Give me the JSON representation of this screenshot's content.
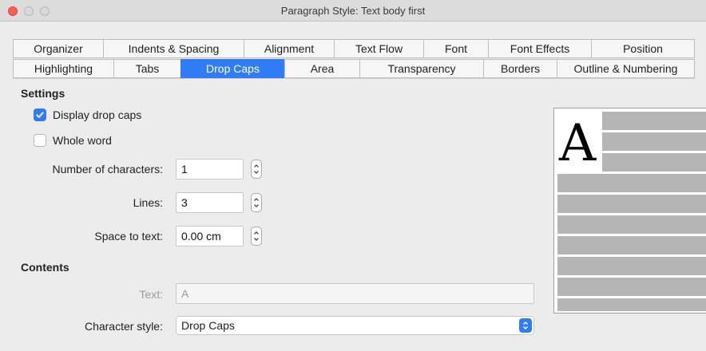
{
  "window": {
    "title": "Paragraph Style: Text body first"
  },
  "tabs": {
    "row1": [
      "Organizer",
      "Indents & Spacing",
      "Alignment",
      "Text Flow",
      "Font",
      "Font Effects",
      "Position"
    ],
    "row2": [
      "Highlighting",
      "Tabs",
      "Drop Caps",
      "Area",
      "Transparency",
      "Borders",
      "Outline & Numbering"
    ],
    "active": "Drop Caps"
  },
  "settings": {
    "title": "Settings",
    "display_drop_caps": {
      "label": "Display drop caps",
      "checked": true
    },
    "whole_word": {
      "label": "Whole word",
      "checked": false
    },
    "num_chars": {
      "label": "Number of characters:",
      "value": "1"
    },
    "lines": {
      "label": "Lines:",
      "value": "3"
    },
    "space_to_text": {
      "label": "Space to text:",
      "value": "0.00 cm"
    }
  },
  "contents": {
    "title": "Contents",
    "text": {
      "label": "Text:",
      "value": "A"
    },
    "char_style": {
      "label": "Character style:",
      "value": "Drop Caps"
    }
  },
  "preview": {
    "letter": "A"
  },
  "colors": {
    "accent": "#2f7cf6",
    "close": "#fe5f57",
    "preview_line": "#b5b5b5"
  },
  "icons": {
    "check": "checkmark-icon",
    "stepper": "up-down-arrows-icon",
    "select": "chevron-up-down-icon"
  }
}
